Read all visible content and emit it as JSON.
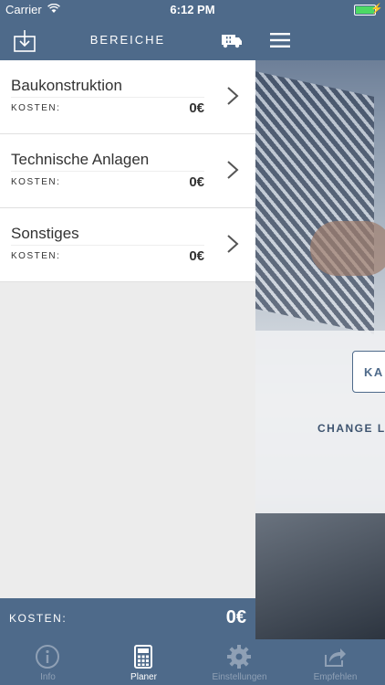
{
  "status_bar": {
    "carrier": "Carrier",
    "time": "6:12 PM"
  },
  "left_panel": {
    "title": "BEREICHE",
    "items": [
      {
        "name": "Baukonstruktion",
        "cost_label": "KOSTEN:",
        "cost_value": "0€"
      },
      {
        "name": "Technische Anlagen",
        "cost_label": "KOSTEN:",
        "cost_value": "0€"
      },
      {
        "name": "Sonstiges",
        "cost_label": "KOSTEN:",
        "cost_value": "0€"
      }
    ],
    "footer": {
      "label": "KOSTEN:",
      "value": "0€"
    }
  },
  "right_panel": {
    "button_label": "KA",
    "change_text": "CHANGE LA"
  },
  "tabbar": {
    "tabs": [
      {
        "label": "Info",
        "icon": "info-icon"
      },
      {
        "label": "Planer",
        "icon": "calculator-icon"
      },
      {
        "label": "Einstellungen",
        "icon": "gear-icon"
      },
      {
        "label": "Empfehlen",
        "icon": "share-icon"
      }
    ],
    "active": "Planer"
  },
  "colors": {
    "nav": "#4e6a8a",
    "inactive_tab": "#8fa0b5",
    "battery": "#4cd964"
  }
}
